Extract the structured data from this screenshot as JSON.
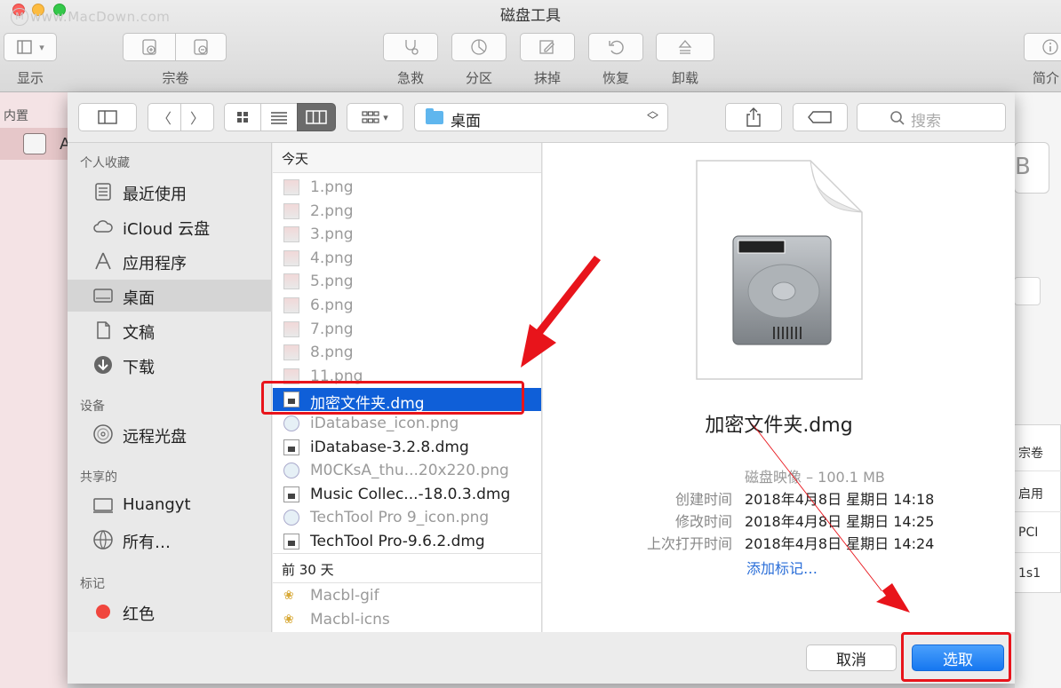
{
  "window": {
    "title": "磁盘工具",
    "watermark": "www.MacDown.com",
    "toolbar": {
      "view": "显示",
      "volume": "宗卷",
      "firstaid": "急救",
      "partition": "分区",
      "erase": "抹掉",
      "restore": "恢复",
      "unmount": "卸载",
      "info": "简介"
    },
    "sidebar_section": "内置",
    "sidebar_item_letter": "A",
    "right_box_text": "B",
    "right_cells": [
      "宗卷",
      "启用",
      "PCI",
      "1s1"
    ]
  },
  "dialog": {
    "location": "桌面",
    "search_placeholder": "搜索",
    "sidebar": {
      "favorites_header": "个人收藏",
      "favorites": [
        "最近使用",
        "iCloud 云盘",
        "应用程序",
        "桌面",
        "文稿",
        "下载"
      ],
      "devices_header": "设备",
      "devices": [
        "远程光盘"
      ],
      "shared_header": "共享的",
      "shared": [
        "Huangyt",
        "所有…"
      ],
      "tags_header": "标记",
      "tags": [
        "红色"
      ],
      "tag_color": "#f0463e"
    },
    "files": {
      "today_header": "今天",
      "today": [
        {
          "name": "1.png",
          "kind": "img",
          "enabled": false
        },
        {
          "name": "2.png",
          "kind": "img",
          "enabled": false
        },
        {
          "name": "3.png",
          "kind": "img",
          "enabled": false
        },
        {
          "name": "4.png",
          "kind": "img",
          "enabled": false
        },
        {
          "name": "5.png",
          "kind": "img",
          "enabled": false
        },
        {
          "name": "6.png",
          "kind": "img",
          "enabled": false
        },
        {
          "name": "7.png",
          "kind": "img",
          "enabled": false
        },
        {
          "name": "8.png",
          "kind": "img",
          "enabled": false
        },
        {
          "name": "11.png",
          "kind": "img",
          "enabled": false
        },
        {
          "name": "加密文件夹.dmg",
          "kind": "dmg",
          "enabled": true,
          "selected": true
        },
        {
          "name": "iDatabase_icon.png",
          "kind": "round",
          "enabled": false
        },
        {
          "name": "iDatabase-3.2.8.dmg",
          "kind": "dmg",
          "enabled": true
        },
        {
          "name": "M0CKsA_thu...20x220.png",
          "kind": "round",
          "enabled": false
        },
        {
          "name": "Music Collec...-18.0.3.dmg",
          "kind": "dmg",
          "enabled": true
        },
        {
          "name": "TechTool Pro 9_icon.png",
          "kind": "round",
          "enabled": false
        },
        {
          "name": "TechTool Pro-9.6.2.dmg",
          "kind": "dmg",
          "enabled": true
        }
      ],
      "past_header": "前 30 天",
      "past": [
        {
          "name": "Macbl-gif",
          "kind": "pine",
          "enabled": false
        },
        {
          "name": "Macbl-icns",
          "kind": "pine",
          "enabled": false
        }
      ]
    },
    "preview": {
      "name": "加密文件夹.dmg",
      "kind_size": "磁盘映像 – 100.1 MB",
      "created_label": "创建时间",
      "created": "2018年4月8日 星期日 14:18",
      "modified_label": "修改时间",
      "modified": "2018年4月8日 星期日 14:25",
      "opened_label": "上次打开时间",
      "opened": "2018年4月8日 星期日 14:24",
      "add_tags": "添加标记…"
    },
    "buttons": {
      "cancel": "取消",
      "choose": "选取"
    },
    "accent": "#0f5fd8",
    "annotation_color": "#e8141b"
  }
}
